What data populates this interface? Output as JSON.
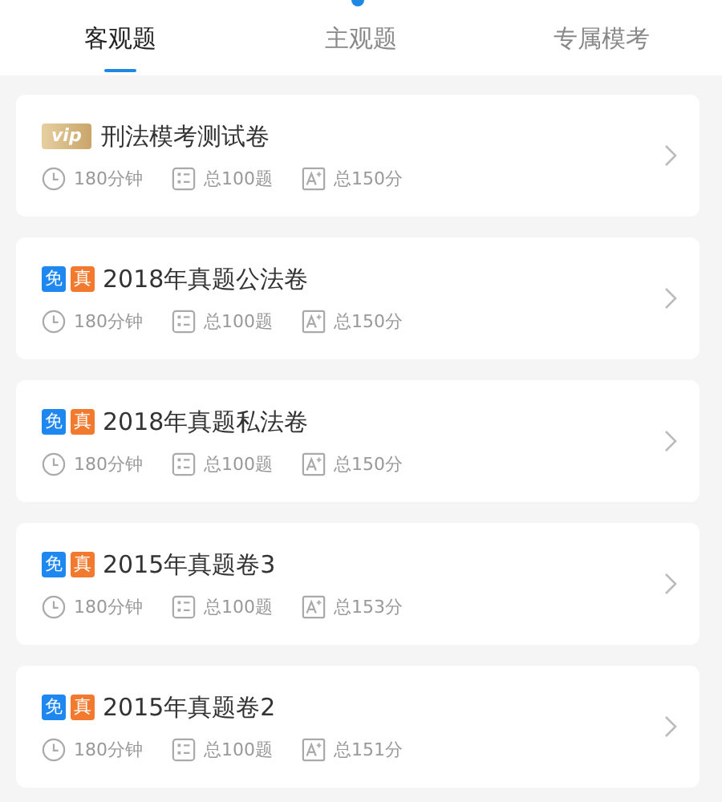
{
  "tabs": [
    {
      "label": "客观题",
      "selected": true
    },
    {
      "label": "主观题",
      "selected": false
    },
    {
      "label": "专属模考",
      "selected": false
    }
  ],
  "papers": [
    {
      "tags": [
        {
          "kind": "vip",
          "text": "vip"
        }
      ],
      "title": "刑法模考测试卷",
      "duration": "180分钟",
      "questions": "总100题",
      "score": "总150分"
    },
    {
      "tags": [
        {
          "kind": "free",
          "text": "免"
        },
        {
          "kind": "real",
          "text": "真"
        }
      ],
      "title": "2018年真题公法卷",
      "duration": "180分钟",
      "questions": "总100题",
      "score": "总150分"
    },
    {
      "tags": [
        {
          "kind": "free",
          "text": "免"
        },
        {
          "kind": "real",
          "text": "真"
        }
      ],
      "title": "2018年真题私法卷",
      "duration": "180分钟",
      "questions": "总100题",
      "score": "总150分"
    },
    {
      "tags": [
        {
          "kind": "free",
          "text": "免"
        },
        {
          "kind": "real",
          "text": "真"
        }
      ],
      "title": "2015年真题卷3",
      "duration": "180分钟",
      "questions": "总100题",
      "score": "总153分"
    },
    {
      "tags": [
        {
          "kind": "free",
          "text": "免"
        },
        {
          "kind": "real",
          "text": "真"
        }
      ],
      "title": "2015年真题卷2",
      "duration": "180分钟",
      "questions": "总100题",
      "score": "总151分"
    }
  ]
}
